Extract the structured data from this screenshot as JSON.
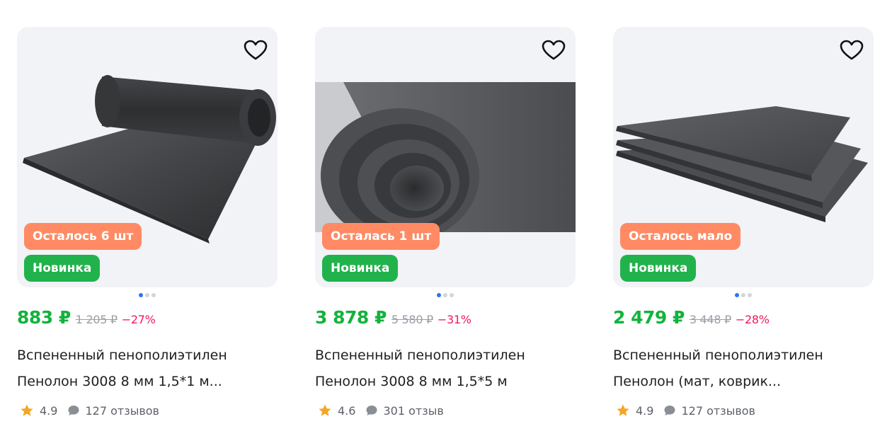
{
  "products": [
    {
      "badge_stock": "Осталось 6 шт",
      "badge_new": "Новинка",
      "price": "883 ₽",
      "old_price": "1 205 ₽",
      "discount": "−27%",
      "title_line1": "Вспененный пенополиэтилен",
      "title_line2": "Пенолон 3008 8 мм 1,5*1 м...",
      "rating": "4.9",
      "reviews": "127 отзывов",
      "image_icon": "rolled-foam-mat",
      "favorite_icon": "heart-icon",
      "carousel_dots": 3,
      "active_dot": 1
    },
    {
      "badge_stock": "Осталась 1 шт",
      "badge_new": "Новинка",
      "price": "3 878 ₽",
      "old_price": "5 580 ₽",
      "discount": "−31%",
      "title_line1": "Вспененный пенополиэтилен",
      "title_line2": "Пенолон 3008 8 мм 1,5*5 м",
      "rating": "4.6",
      "reviews": "301 отзыв",
      "image_icon": "foam-roll-closeup",
      "favorite_icon": "heart-icon",
      "carousel_dots": 3,
      "active_dot": 1
    },
    {
      "badge_stock": "Осталось мало",
      "badge_new": "Новинка",
      "price": "2 479 ₽",
      "old_price": "3 448 ₽",
      "discount": "−28%",
      "title_line1": "Вспененный пенополиэтилен",
      "title_line2": "Пенолон (мат, коврик...",
      "rating": "4.9",
      "reviews": "127 отзывов",
      "image_icon": "foam-sheets-stack",
      "favorite_icon": "heart-icon",
      "carousel_dots": 3,
      "active_dot": 1
    }
  ],
  "colors": {
    "price": "#12b33c",
    "discount": "#f11a5b",
    "old_price": "#9a9ea6",
    "badge_stock": "#ff8a63",
    "badge_new": "#22b24c",
    "dot_active": "#2a73ff",
    "star": "#f5a623"
  }
}
